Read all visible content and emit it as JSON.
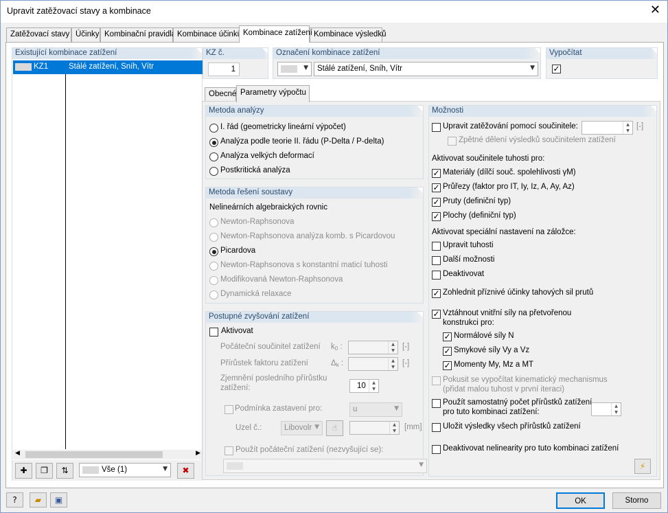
{
  "window": {
    "title": "Upravit zatěžovací stavy a kombinace",
    "close_icon": "close-icon"
  },
  "tabs": [
    "Zatěžovací stavy",
    "Účinky",
    "Kombinační pravidla",
    "Kombinace účinků",
    "Kombinace zatížení",
    "Kombinace výsledků"
  ],
  "existing": {
    "header": "Existující kombinace zatížení",
    "rows": [
      {
        "id": "KZ1",
        "name": "Stálé zatížení, Sníh, Vítr"
      }
    ],
    "filter": "Vše (1)"
  },
  "kz": {
    "label": "KZ č.",
    "value": "1"
  },
  "designation": {
    "label": "Označení kombinace zatížení",
    "value": "Stálé zatížení, Sníh, Vítr"
  },
  "calculate": {
    "label": "Vypočítat",
    "checked": "✓"
  },
  "subtabs": [
    "Obecné",
    "Parametry výpočtu"
  ],
  "analysis_method": {
    "title": "Metoda analýzy",
    "options": [
      "I. řád (geometricky lineární výpočet)",
      "Analýza podle teorie II. řádu (P-Delta / P-delta)",
      "Analýza velkých deformací",
      "Postkritická analýza"
    ]
  },
  "solver": {
    "title": "Metoda řešení soustavy",
    "subtitle": "Nelineárních algebraických rovnic",
    "options": [
      "Newton-Raphsonova",
      "Newton-Raphsonova analýza komb. s Picardovou",
      "Picardova",
      "Newton-Raphsonova s konstantní maticí tuhosti",
      "Modifikovaná Newton-Raphsonova",
      "Dynamická relaxace"
    ]
  },
  "incremental": {
    "title": "Postupné zvyšování zatížení",
    "activate": "Aktivovat",
    "initial_factor": "Počáteční součinitel zatížení",
    "initial_sym": "k",
    "initial_sub": "0",
    "increment": "Přírůstek faktoru zatížení",
    "increment_sym": "Δ",
    "increment_sub": "k",
    "reduction_1": "Zjemnění posledního přírůstku",
    "reduction_2": "zatížení:",
    "reduction_value": "10",
    "unit": "[-]",
    "stop_condition": "Podmínka zastavení pro:",
    "stop_value": "u",
    "node": "Uzel č.:",
    "node_value": "Libovolr",
    "mm": "[mm]",
    "use_initial": "Použít počáteční zatížení (nezvyšující se):"
  },
  "options": {
    "title": "Možnosti",
    "modify_load": "Upravit zatěžování pomocí součinitele:",
    "unit": "[-]",
    "back_division": "Zpětné dělení výsledků součinitelem zatížení",
    "stiffness_title": "Aktivovat součinitele tuhosti pro:",
    "materials": "Materiály (dílčí souč. spolehlivosti γM)",
    "sections": "Průřezy (faktor pro IT, Iy, Iz, A, Ay, Az)",
    "members": "Pruty (definiční typ)",
    "surfaces": "Plochy (definiční typ)",
    "special_title": "Aktivovat speciální nastavení na záložce:",
    "modify_stiff": "Upravit tuhosti",
    "more_options": "Další možnosti",
    "deactivate": "Deaktivovat",
    "favorable": "Zohlednit příznivé účinky tahových sil prutů",
    "refer_1": "Vztáhnout vnitřní síly na přetvořenou",
    "refer_2": "konstrukci pro:",
    "normal": "Normálové síly N",
    "shear": "Smykové síly Vy a Vz",
    "moments": "Momenty My, Mz a MT",
    "kinematic_1": "Pokusit se vypočítat kinematický mechanismus",
    "kinematic_2": "(přidat malou tuhost v první iteraci)",
    "separate_1": "Použít samostatný počet přírůstků zatížení",
    "separate_2": "pro tuto kombinaci zatížení:",
    "save_all": "Uložit výsledky všech přírůstků zatížení",
    "deactivate_nl": "Deaktivovat nelinearity pro tuto kombinaci zatížení"
  },
  "footer": {
    "ok": "OK",
    "cancel": "Storno"
  },
  "colors": {
    "selection": "#0078d7",
    "accent": "#2b4b6e"
  }
}
